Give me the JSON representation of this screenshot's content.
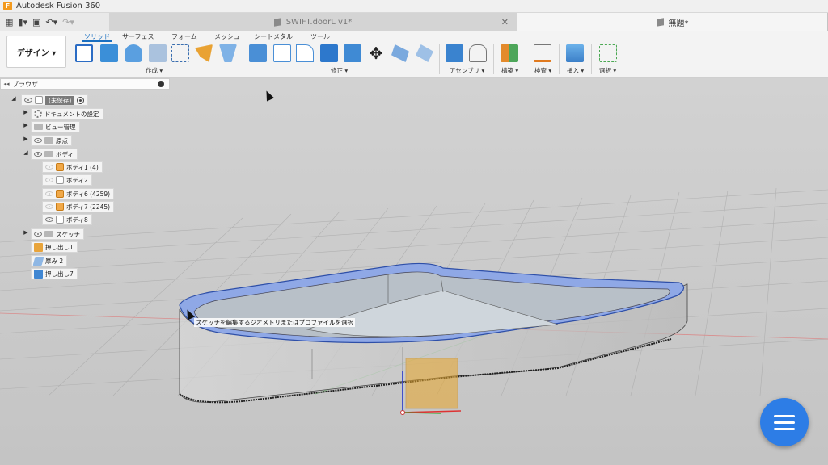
{
  "window": {
    "title": "Autodesk Fusion 360"
  },
  "quick_access": {
    "grid_icon": "app-grid-icon",
    "file_icon": "file-icon",
    "save_icon": "save-icon",
    "undo_icon": "undo-icon",
    "redo_icon": "redo-icon"
  },
  "tabs": [
    {
      "label": "SWIFT.doorL v1*",
      "active": false
    },
    {
      "label": "無題*",
      "active": true
    }
  ],
  "ribbon": {
    "workspace": "デザイン ▾",
    "tabs": [
      "ソリッド",
      "サーフェス",
      "フォーム",
      "メッシュ",
      "シートメタル",
      "ツール"
    ],
    "active_tab": "ソリッド",
    "groups": [
      "作成 ▾",
      "修正 ▾",
      "アセンブリ ▾",
      "構築 ▾",
      "検査 ▾",
      "挿入 ▾",
      "選択 ▾"
    ]
  },
  "browser": {
    "header_arrows": "◂◂",
    "title": "ブラウザ",
    "root": "(未保存)",
    "nodes": {
      "doc_settings": "ドキュメントの設定",
      "views": "ビュー管理",
      "origin": "原点",
      "bodies": "ボディ",
      "body1": "ボディ1 (4)",
      "body2": "ボディ2",
      "body6": "ボディ6 (4259)",
      "body7": "ボディ7 (2245)",
      "body8": "ボディ8",
      "sketches": "スケッチ",
      "extrude1": "押し出し1",
      "thicken2": "厚み 2",
      "extrude7": "押し出し7"
    }
  },
  "viewport": {
    "tooltip": "スケッチを編集するジオメトリまたはプロファイルを選択",
    "accent_colors": {
      "selection": "#8fa8e6",
      "origin_box": "#e9a72b",
      "x_axis": "#d33",
      "y_axis": "#2a2",
      "z_axis": "#22c"
    }
  },
  "fab": {
    "icon": "menu-icon"
  }
}
